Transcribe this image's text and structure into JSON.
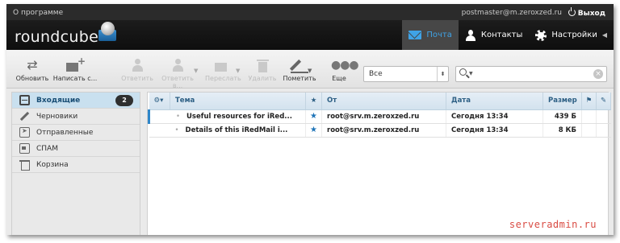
{
  "topline": {
    "about": "О программе",
    "user": "postmaster@m.zeroxzed.ru",
    "logout": "Выход"
  },
  "logo": {
    "text": "roundcube"
  },
  "nav": [
    {
      "label": "Почта",
      "icon": "mail-icon",
      "active": true
    },
    {
      "label": "Контакты",
      "icon": "contacts-icon"
    },
    {
      "label": "Настройки",
      "icon": "settings-icon"
    }
  ],
  "toolbar": {
    "refresh": "Обновить",
    "compose": "Написать с...",
    "reply": "Ответить",
    "reply_all": "Ответить в...",
    "forward": "Переслать",
    "delete": "Удалить",
    "mark": "Пометить",
    "more": "Еще"
  },
  "filter": {
    "value": "Все"
  },
  "search": {
    "value": ""
  },
  "folders": [
    {
      "label": "Входящие",
      "icon": "inbox-icon",
      "count": "2",
      "active": true
    },
    {
      "label": "Черновики",
      "icon": "drafts-icon"
    },
    {
      "label": "Отправленные",
      "icon": "sent-icon"
    },
    {
      "label": "СПАМ",
      "icon": "spam-icon"
    },
    {
      "label": "Корзина",
      "icon": "trash-icon"
    }
  ],
  "list": {
    "columns": {
      "subject": "Тема",
      "from": "От",
      "date": "Дата",
      "size": "Размер"
    },
    "messages": [
      {
        "subject": "Useful resources for iRed...",
        "from": "root@srv.m.zeroxzed.ru",
        "date": "Сегодня 13:34",
        "size": "439 Б"
      },
      {
        "subject": "Details of this iRedMail i...",
        "from": "root@srv.m.zeroxzed.ru",
        "date": "Сегодня 13:34",
        "size": "8 КБ"
      }
    ]
  },
  "watermark": "serveradmin.ru",
  "colors": {
    "accent": "#3fa3e6",
    "star": "#1f74b8",
    "badge": "#2f2f2f"
  }
}
